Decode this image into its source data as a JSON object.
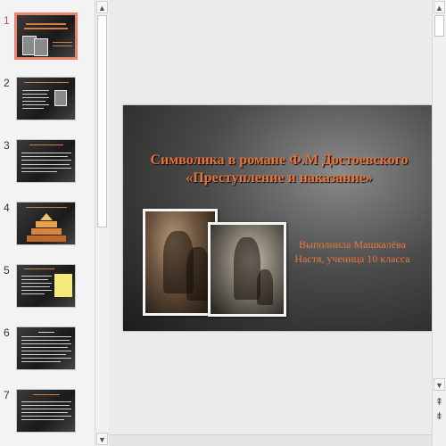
{
  "thumbnails": [
    {
      "num": "1",
      "active": true
    },
    {
      "num": "2",
      "active": false
    },
    {
      "num": "3",
      "active": false
    },
    {
      "num": "4",
      "active": false
    },
    {
      "num": "5",
      "active": false
    },
    {
      "num": "6",
      "active": false
    },
    {
      "num": "7",
      "active": false
    }
  ],
  "slide": {
    "title": "Символика в романе Ф.М Достоевского «Преступление и наказание»",
    "subtitle": "Выполнила Машкалёва Настя, ученица 10 класса"
  },
  "scrollbar": {
    "up_icon": "triangle-up",
    "down_icon": "triangle-down",
    "prev_slide_icon": "double-chevron-up",
    "next_slide_icon": "double-chevron-down"
  },
  "colors": {
    "accent": "#e8743b",
    "active_thumb_border": "#e9836b",
    "active_number": "#c0504d"
  }
}
